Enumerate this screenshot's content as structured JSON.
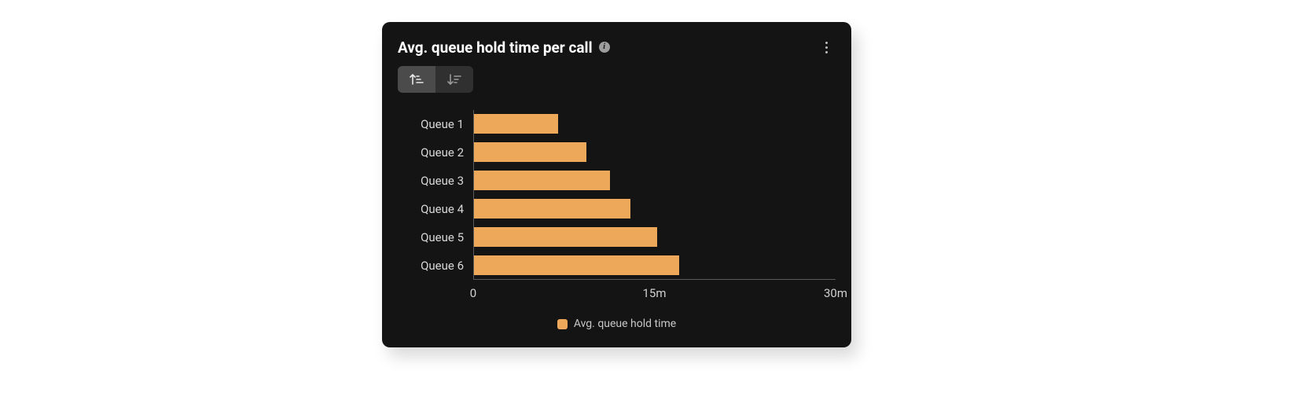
{
  "card": {
    "title": "Avg. queue hold time per call",
    "info_glyph": "i"
  },
  "legend": {
    "label": "Avg. queue hold time"
  },
  "xaxis": {
    "ticks": [
      "0",
      "15m",
      "30m"
    ]
  },
  "chart_data": {
    "type": "bar",
    "orientation": "horizontal",
    "categories": [
      "Queue 1",
      "Queue 2",
      "Queue 3",
      "Queue 4",
      "Queue 5",
      "Queue 6"
    ],
    "series": [
      {
        "name": "Avg. queue hold time",
        "values": [
          7,
          9.3,
          11.3,
          13,
          15.2,
          17
        ],
        "unit": "minutes"
      }
    ],
    "title": "Avg. queue hold time per call",
    "xlabel": "",
    "ylabel": "",
    "xlim": [
      0,
      30
    ],
    "xticks": [
      0,
      15,
      30
    ],
    "color": "#eda85a"
  }
}
